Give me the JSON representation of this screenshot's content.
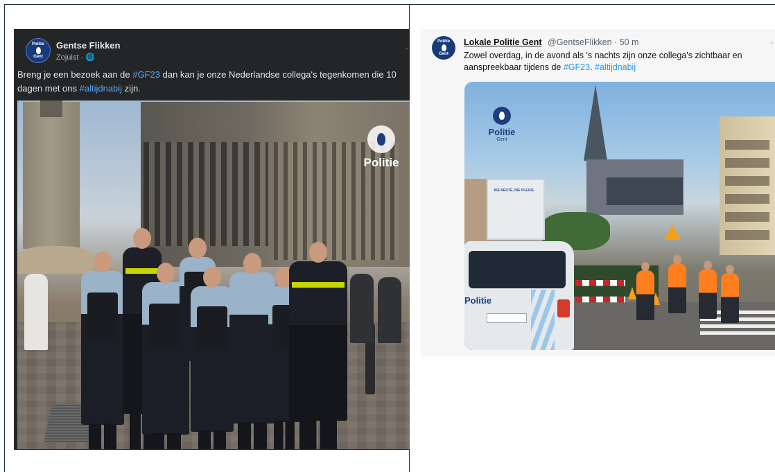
{
  "facebook_post": {
    "page_name": "Gentse Flikken",
    "meta": "Zojuist · 🌐",
    "more": "·",
    "avatar_lines": [
      "Politie",
      "Gent"
    ],
    "text_before": "Breng je een bezoek aan de ",
    "hashtag1": "#GF23",
    "text_middle": " dan kan je onze Nederlandse collega's tegenkomen die 10 dagen met ons ",
    "hashtag2": "#altijdnabij",
    "text_after": " zijn.",
    "photo_watermark": "Politie"
  },
  "twitter_post": {
    "display_name": "Lokale Politie Gent",
    "handle_time": "@GentseFlikken · 50 m",
    "more": "·",
    "avatar_lines": [
      "Politie",
      "Gent"
    ],
    "text_before": "Zowel overdag, in de avond als 's nachts zijn onze collega's zichtbaar en aanspreekbaar tijdens de ",
    "hashtag1": "#GF23",
    "text_middle": ". ",
    "hashtag2": "#altijdnabij",
    "photo": {
      "logo_word": "Politie",
      "logo_sub": "Gent",
      "poster_text": "NIE NEUTE, NIE PLEUIE.",
      "van_word": "Politie"
    }
  },
  "colors": {
    "facebook_bg": "#242526",
    "facebook_link": "#5aa7ff",
    "twitter_link": "#1d9bf0",
    "police_blue": "#1c3e7c"
  }
}
